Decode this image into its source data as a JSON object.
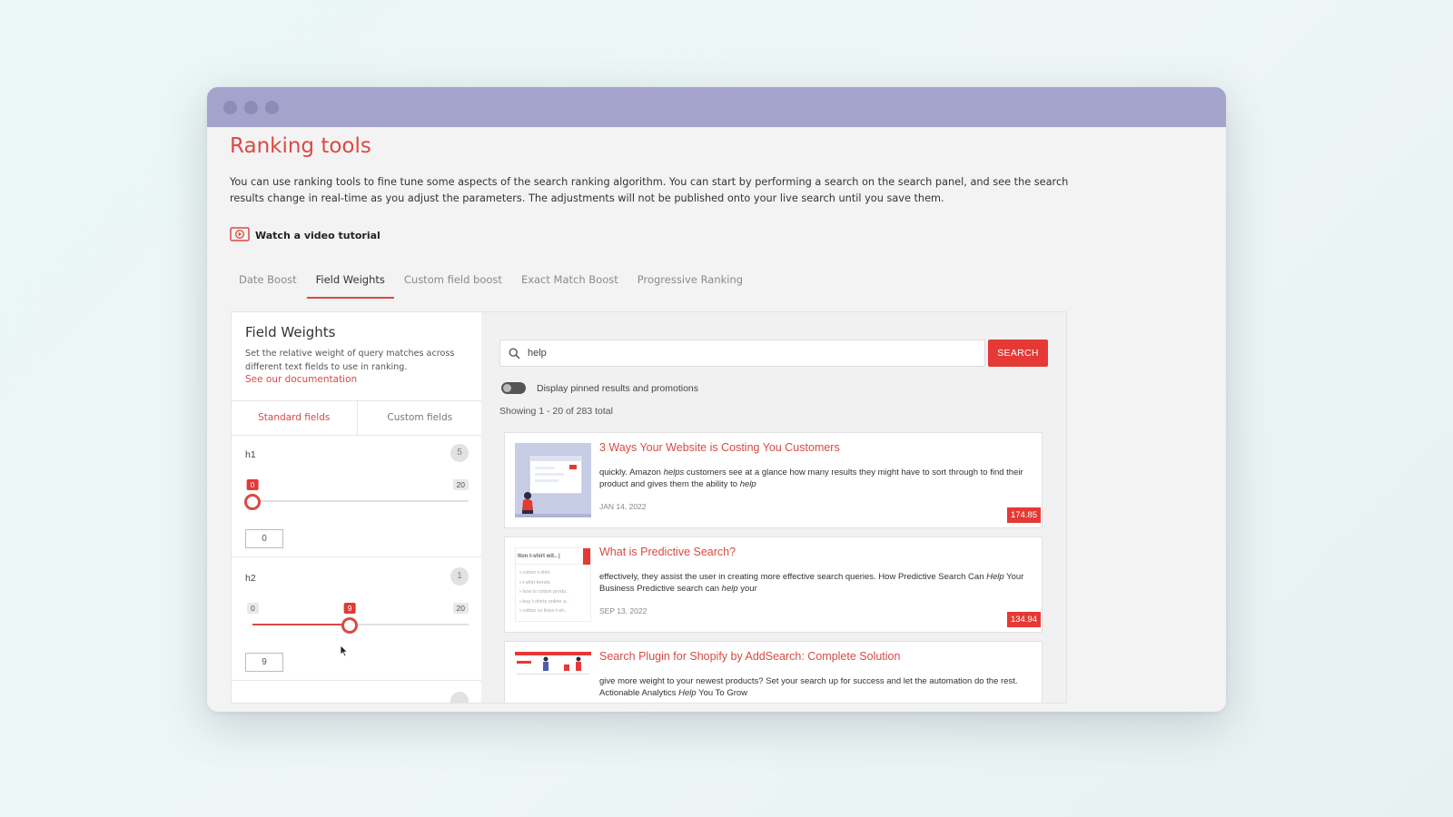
{
  "page": {
    "title": "Ranking tools",
    "intro": "You can use ranking tools to fine tune some aspects of the search ranking algorithm. You can start by performing a search on the search panel, and see the search results change in real-time as you adjust the parameters. The adjustments will not be published onto your live search until you save them.",
    "video_link": "Watch a video tutorial"
  },
  "tabs": [
    {
      "label": "Date Boost",
      "active": false
    },
    {
      "label": "Field Weights",
      "active": true
    },
    {
      "label": "Custom field boost",
      "active": false
    },
    {
      "label": "Exact Match Boost",
      "active": false
    },
    {
      "label": "Progressive Ranking",
      "active": false
    }
  ],
  "field_weights": {
    "title": "Field Weights",
    "description": "Set the relative weight of query matches across different text fields to use in ranking.",
    "doc_link": "See our documentation",
    "subtabs": [
      "Standard fields",
      "Custom fields"
    ],
    "fields": [
      {
        "label": "h1",
        "badge": "5",
        "min": "0",
        "max": "20",
        "current": "0",
        "value": 0,
        "input": "0"
      },
      {
        "label": "h2",
        "badge": "1",
        "min": "0",
        "max": "20",
        "current": "9",
        "value": 9,
        "input": "9"
      }
    ]
  },
  "search": {
    "value": "help",
    "button": "SEARCH",
    "toggle_label": "Display pinned results and promotions",
    "toggle_on": false,
    "showing": "Showing 1 - 20 of 283 total"
  },
  "results": [
    {
      "title": "3 Ways Your Website is Costing You Customers",
      "snippet_a": "quickly. Amazon ",
      "snippet_em1": "helps",
      "snippet_b": " customers see at a glance how many results they might have to sort through to find their product and gives them the ability to ",
      "snippet_em2": "help",
      "snippet_c": "",
      "date": "JAN 14, 2022",
      "score": "174.85"
    },
    {
      "title": "What is Predictive Search?",
      "snippet_a": "effectively, they assist the user in creating more effective search queries. How Predictive Search Can ",
      "snippet_em1": "Help",
      "snippet_b": " Your Business Predictive search can ",
      "snippet_em2": "help",
      "snippet_c": " your",
      "date": "SEP 13, 2022",
      "score": "134.94"
    },
    {
      "title": "Search Plugin for Shopify by AddSearch: Complete Solution",
      "snippet_a": "give more weight to your newest products? Set your search up for success and let the automation do the rest. Actionable Analytics ",
      "snippet_em1": "Help",
      "snippet_b": " You To Grow",
      "snippet_em2": "",
      "snippet_c": "",
      "date": "",
      "score": ""
    }
  ],
  "thumbnail_texts": {
    "predictive": [
      "tton t-shirt wit.. |",
      "cotton t-shirt",
      "t-shirt trends",
      "how is cotton produ..",
      "buy t-shirts online a..",
      "cotton vs linen t-sh.."
    ]
  },
  "colors": {
    "accent": "#d94a43",
    "titlebar": "#a3a3cc",
    "button": "#e53935"
  }
}
